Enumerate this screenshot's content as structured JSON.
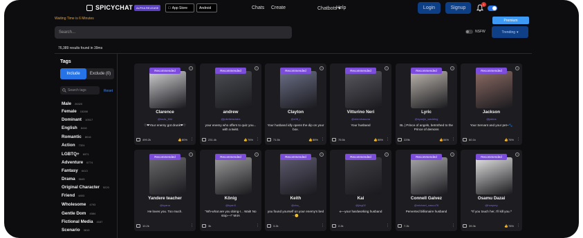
{
  "header": {
    "brand": "SPICYCHAT",
    "alpha_badge": "ALPHA RELEASE",
    "app_store": "App Store",
    "android": "Android",
    "nav": [
      "Chats",
      "Create",
      "Chatbots",
      "Help"
    ],
    "login": "Login",
    "signup": "Signup",
    "notification_count": "1"
  },
  "waiting_text": "Waiting Time is 6 Minutes",
  "premium_label": "Premium",
  "search": {
    "placeholder": "Search..."
  },
  "nsfw_label": "NSFW",
  "sort_label": "Trending",
  "results_text": "76,389 results found in 39ms",
  "sidebar": {
    "title": "Tags",
    "include_label": "Include",
    "exclude_label": "Exclude (0)",
    "search_placeholder": "Search tags",
    "reset_label": "Reset",
    "tags": [
      {
        "name": "Male",
        "count": "26320"
      },
      {
        "name": "Female",
        "count": "15288"
      },
      {
        "name": "Dominant",
        "count": "10517"
      },
      {
        "name": "English",
        "count": "8416"
      },
      {
        "name": "Romantic",
        "count": "8016"
      },
      {
        "name": "Action",
        "count": "7324"
      },
      {
        "name": "LGBTQ+",
        "count": "6971"
      },
      {
        "name": "Adventure",
        "count": "6774"
      },
      {
        "name": "Fantasy",
        "count": "6413"
      },
      {
        "name": "Drama",
        "count": "5645"
      },
      {
        "name": "Original Character",
        "count": "5220"
      },
      {
        "name": "Friend",
        "count": "4803"
      },
      {
        "name": "Wholesome",
        "count": "4793"
      },
      {
        "name": "Gentle Dom",
        "count": "4584"
      },
      {
        "name": "Fictional Media",
        "count": "4167"
      },
      {
        "name": "Scenario",
        "count": "3815"
      }
    ]
  },
  "cards": [
    {
      "badge": "Recommended",
      "name": "Clarence",
      "handle": "@touls_Kiki",
      "desc": "♡❤Your enemy got drunk❤♡",
      "chats": "499.2k",
      "likes": "80%",
      "color": "#cfcfd2"
    },
    {
      "badge": "Recommended",
      "name": "andrew",
      "handle": "@juliettelaclairs",
      "desc": "your enemy who offers to quiz you... with a twist.",
      "chats": "231.4k",
      "likes": "76%",
      "color": "#4b4d52"
    },
    {
      "badge": "Recommended",
      "name": "Clayton",
      "handle": "@x0ft_r",
      "desc": "Your husband idly opens the dip on your box.",
      "chats": "71.5k",
      "likes": "88%",
      "color": "#6b6f86"
    },
    {
      "badge": "Recommended",
      "name": "Vitturino Neri",
      "handle": "@sbemhasuna",
      "desc": "Your husband",
      "chats": "75.5k",
      "likes": "88%",
      "color": "#5a5860"
    },
    {
      "badge": "Recommended",
      "name": "Lyric",
      "handle": "@kyunjin_wadding",
      "desc": "BL | Prince of angels, betrothed to the Prince of demons",
      "chats": "229k",
      "likes": "84%",
      "color": "#bdb6ae"
    },
    {
      "badge": "Recommended",
      "name": "Jackson",
      "handle": "@jaklos",
      "desc": "Your Servant and your pet~🐾",
      "chats": "60.1k",
      "likes": "76%",
      "color": "#8c6b64"
    },
    {
      "badge": "Recommended",
      "name": "Yandere teacher",
      "handle": "@kyana",
      "desc": "He loves you. Too much.",
      "chats": "10.2k",
      "likes": "",
      "color": "#6a6a6c"
    },
    {
      "badge": "Recommended",
      "name": "König",
      "handle": "@kyan3",
      "desc": "\"Wh-what are you doing-!... Wait! No stop—!\" M4A",
      "chats": "3k",
      "likes": "",
      "color": "#9b9b9b"
    },
    {
      "badge": "Recommended",
      "name": "Keith",
      "handle": "@cha_",
      "desc": "you found yourself on your enemy's bed - 😶",
      "chats": "3.2k",
      "likes": "",
      "color": "#5d5a6e"
    },
    {
      "badge": "Recommended",
      "name": "Kai",
      "handle": "@jing02",
      "desc": "⟡—your hardworking husband",
      "chats": "2.2k",
      "likes": "",
      "color": "#3f3f45"
    },
    {
      "badge": "Recommended",
      "name": "Connell Galvez",
      "handle": "@michael_nasuu76",
      "desc": "Perverted billionaire husband",
      "chats": "7.2k",
      "likes": "",
      "color": "#a7a6a8"
    },
    {
      "badge": "Recommended",
      "name": "Osamu Dazai",
      "handle": "@husprey",
      "desc": "^If you touch her, I'll kill you.^",
      "chats": "39.3k",
      "likes": "78%",
      "color": "#e4e4e4"
    }
  ]
}
